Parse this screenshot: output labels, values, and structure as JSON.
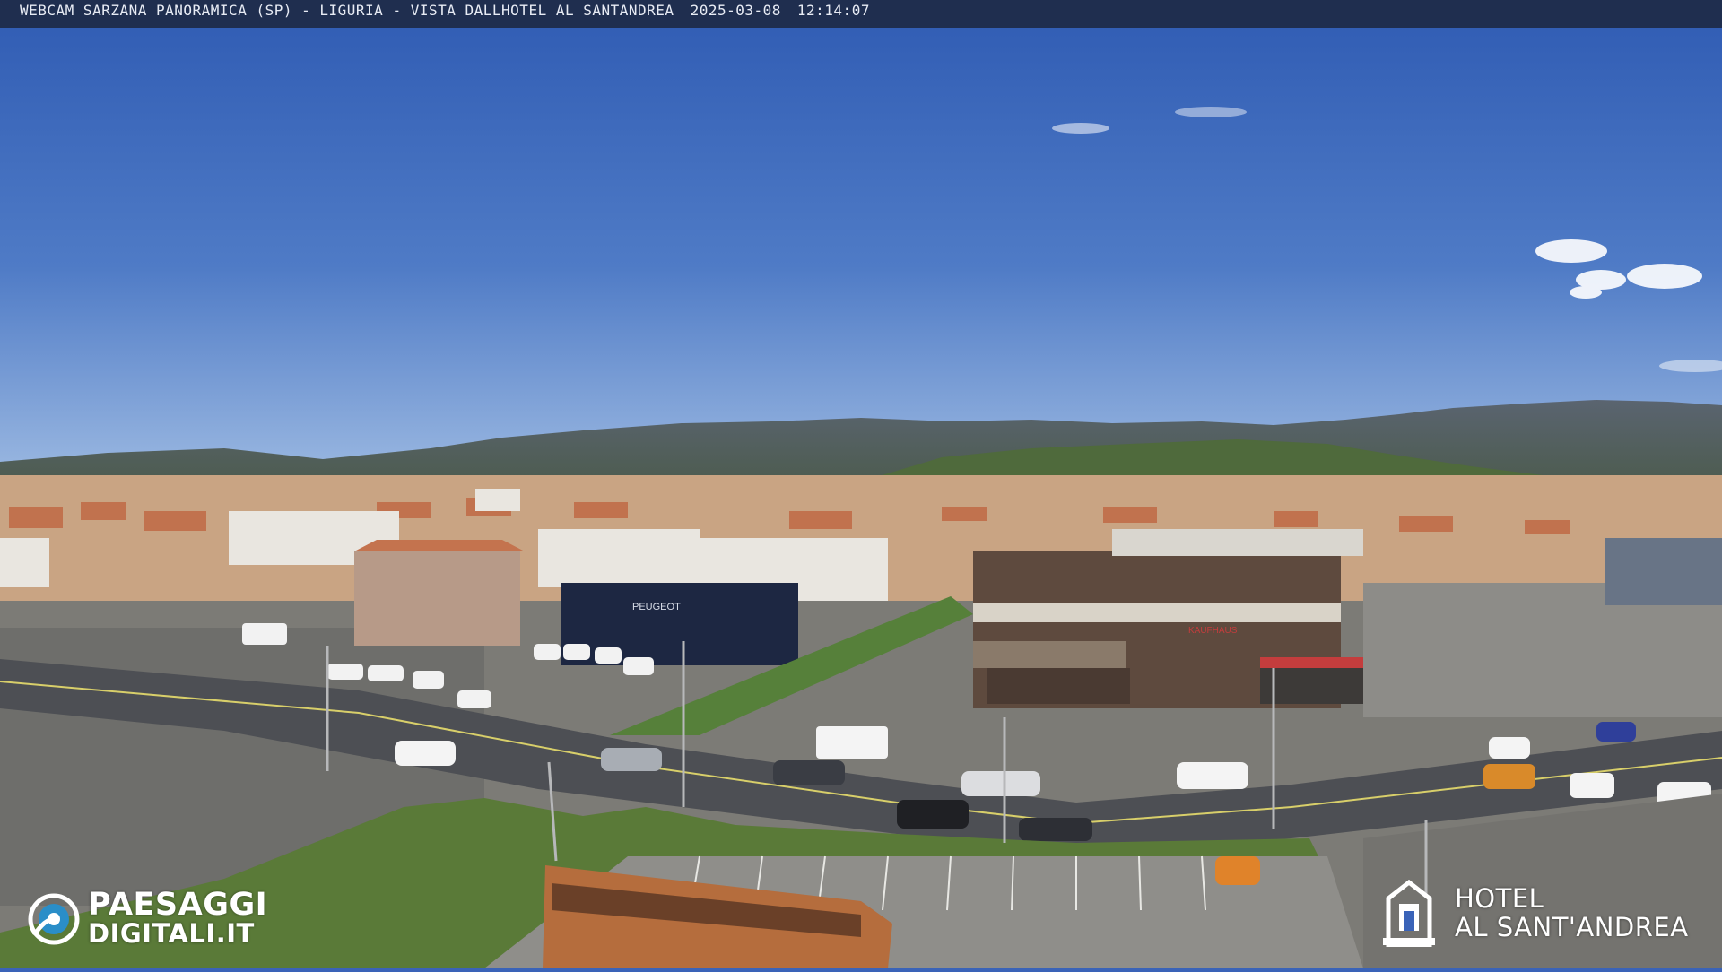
{
  "overlay": {
    "title": "WEBCAM SARZANA PANORAMICA (SP) - LIGURIA - VISTA DALLHOTEL AL SANTANDREA",
    "date": "2025-03-08",
    "time": "12:14:07"
  },
  "logo_left": {
    "line1": "PAESAGGI",
    "line2": "DIGITALI.IT",
    "icon": "eye-icon"
  },
  "logo_right": {
    "line1": "HOTEL",
    "line2": "AL SANT'ANDREA",
    "icon": "hotel-building-icon"
  },
  "signs": {
    "dealership": "PEUGEOT",
    "shop": "KAUFHAUS"
  },
  "colors": {
    "sky_top": "#2f5bb3",
    "sky_horizon": "#8fb0e0",
    "hills": "#4f5a56",
    "vegetation": "#5e7a3c",
    "road": "#5a5c60",
    "town_roofs": "#c8714d",
    "bus": "#b06a3b"
  }
}
